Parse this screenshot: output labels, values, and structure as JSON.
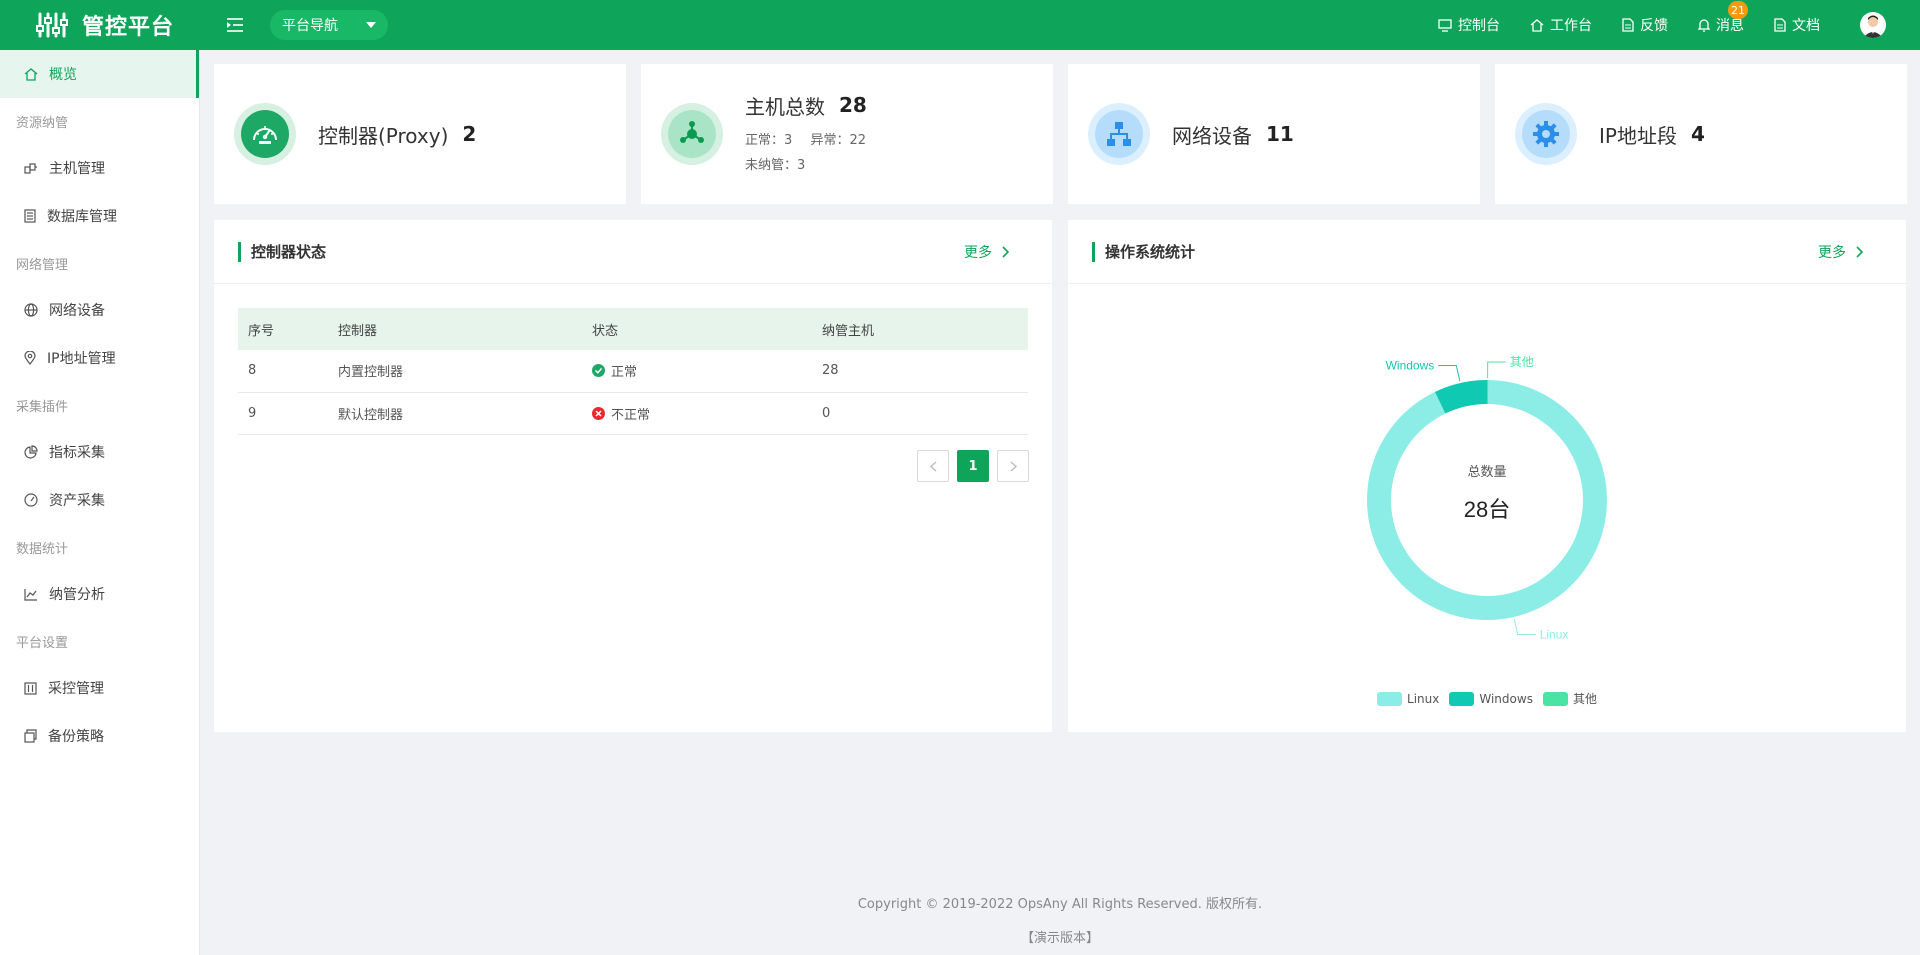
{
  "header": {
    "logo_text": "管控平台",
    "nav_select": "平台导航",
    "links": [
      {
        "label": "控制台",
        "icon": "monitor-icon"
      },
      {
        "label": "工作台",
        "icon": "home-icon"
      },
      {
        "label": "反馈",
        "icon": "document-icon"
      },
      {
        "label": "消息",
        "icon": "bell-icon",
        "badge": "21"
      },
      {
        "label": "文档",
        "icon": "document-icon"
      }
    ],
    "brand_color": "#0ea55a"
  },
  "sidebar": {
    "active": "概览",
    "overview": "概览",
    "groups": [
      {
        "title": "资源纳管",
        "items": [
          "主机管理",
          "数据库管理"
        ]
      },
      {
        "title": "网络管理",
        "items": [
          "网络设备",
          "IP地址管理"
        ]
      },
      {
        "title": "采集插件",
        "items": [
          "指标采集",
          "资产采集"
        ]
      },
      {
        "title": "数据统计",
        "items": [
          "纳管分析"
        ]
      },
      {
        "title": "平台设置",
        "items": [
          "采控管理",
          "备份策略"
        ]
      }
    ]
  },
  "stats": [
    {
      "title": "控制器(Proxy)",
      "value": "2"
    },
    {
      "title": "主机总数",
      "value": "28",
      "normal_label": "正常：",
      "normal": "3",
      "abnormal_label": "异常：",
      "abnormal": "22",
      "unmanaged_label": "未纳管：",
      "unmanaged": "3"
    },
    {
      "title": "网络设备",
      "value": "11"
    },
    {
      "title": "IP地址段",
      "value": "4"
    }
  ],
  "controller_panel": {
    "title": "控制器状态",
    "more": "更多",
    "columns": [
      "序号",
      "控制器",
      "状态",
      "纳管主机"
    ],
    "rows": [
      {
        "id": "8",
        "name": "内置控制器",
        "status": "正常",
        "ok": true,
        "hosts": "28"
      },
      {
        "id": "9",
        "name": "默认控制器",
        "status": "不正常",
        "ok": false,
        "hosts": "0"
      }
    ],
    "page": "1"
  },
  "os_panel": {
    "title": "操作系统统计",
    "more": "更多",
    "center_label": "总数量",
    "center_value": "28台"
  },
  "chart_data": {
    "type": "pie",
    "donut": true,
    "title": "",
    "categories": [
      "Linux",
      "Windows",
      "其他"
    ],
    "values": [
      26,
      2,
      0
    ],
    "colors": [
      "#8cede6",
      "#10c9b2",
      "#4be3a4"
    ],
    "legend": "bottom"
  },
  "footer": {
    "copyright": "Copyright © 2019-2022 OpsAny All Rights Reserved. 版权所有.",
    "demo": "【演示版本】"
  }
}
